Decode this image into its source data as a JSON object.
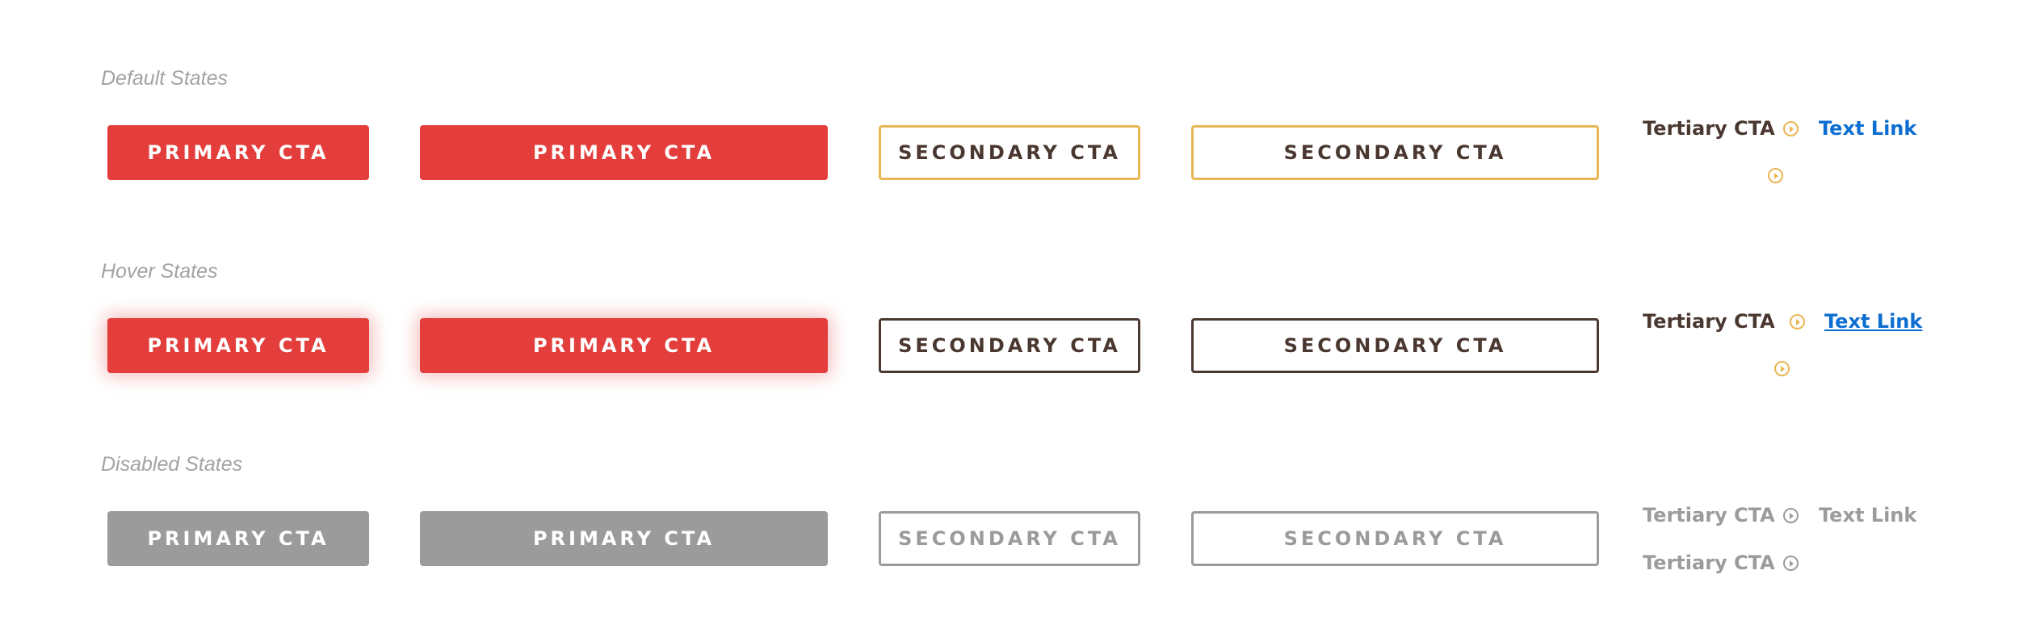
{
  "colors": {
    "primary": "#e33e3b",
    "secondary_border": "#e9b654",
    "dark": "#4a3830",
    "disabled": "#9b9b9b",
    "link": "#0d6ed1",
    "label": "#a3a3a3"
  },
  "sections": {
    "default": {
      "label": "Default States",
      "primary_small": "PRIMARY CTA",
      "primary_large": "PRIMARY CTA",
      "secondary_small": "SECONDARY CTA",
      "secondary_large": "SECONDARY CTA",
      "tertiary": "Tertiary CTA",
      "text_link": "Text Link"
    },
    "hover": {
      "label": "Hover States",
      "primary_small": "PRIMARY CTA",
      "primary_large": "PRIMARY CTA",
      "secondary_small": "SECONDARY CTA",
      "secondary_large": "SECONDARY CTA",
      "tertiary": "Tertiary CTA",
      "text_link": "Text Link"
    },
    "disabled": {
      "label": "Disabled States",
      "primary_small": "PRIMARY CTA",
      "primary_large": "PRIMARY CTA",
      "secondary_small": "SECONDARY CTA",
      "secondary_large": "SECONDARY CTA",
      "tertiary": "Tertiary CTA",
      "tertiary_second": "Tertiary CTA",
      "text_link": "Text Link"
    }
  },
  "icons": {
    "tertiary_arrow": "circle-arrow-right-icon"
  }
}
